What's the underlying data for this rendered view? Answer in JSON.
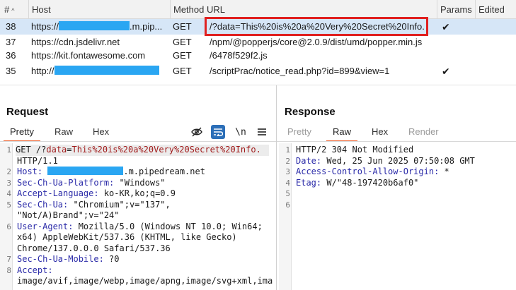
{
  "table": {
    "headers": [
      "#",
      "Host",
      "Method",
      "URL",
      "Params",
      "Edited"
    ],
    "sort_indicator": "^",
    "rows": [
      {
        "num": "38",
        "host_prefix": "https://",
        "host_suffix": ".m.pip...",
        "method": "GET",
        "url": "/?data=This%20is%20a%20Very%20Secret%20Info.",
        "params": "✔",
        "selected": true
      },
      {
        "num": "37",
        "host_prefix": "https://cdn.jsdelivr.net",
        "host_suffix": "",
        "method": "GET",
        "url": "/npm/@popperjs/core@2.0.9/dist/umd/popper.min.js",
        "params": "",
        "selected": false
      },
      {
        "num": "36",
        "host_prefix": "https://kit.fontawesome.com",
        "host_suffix": "",
        "method": "GET",
        "url": "/6478f529f2.js",
        "params": "",
        "selected": false
      },
      {
        "num": "35",
        "host_prefix": "http://",
        "host_suffix": "",
        "method": "GET",
        "url": "/scriptPrac/notice_read.php?id=899&view=1",
        "params": "✔",
        "selected": false
      }
    ]
  },
  "request": {
    "title": "Request",
    "tabs": [
      "Pretty",
      "Raw",
      "Hex"
    ],
    "active_tab": "Pretty",
    "tools": {
      "hide_icon": "eye-slash-icon",
      "wrap_icon": "wrap-lines-icon",
      "newline_label": "\\n",
      "menu_icon": "hamburger-menu-icon"
    },
    "lines": {
      "l1_method": "GET /?",
      "l1_param": "data",
      "l1_eq": "=",
      "l1_value": "This%20is%20a%20Very%20Secret%20Info.",
      "l1_version": "HTTP/1.1",
      "l2_name": "Host:",
      "l2_suffix": ".m.pipedream.net",
      "l3_name": "Sec-Ch-Ua-Platform:",
      "l3_value": " \"Windows\"",
      "l4_name": "Accept-Language:",
      "l4_value": " ko-KR,ko;q=0.9",
      "l5_name": "Sec-Ch-Ua:",
      "l5_value_a": " \"Chromium\";v=\"137\",",
      "l5_value_b": "\"Not/A)Brand\";v=\"24\"",
      "l6_name": "User-Agent:",
      "l6_value_a": " Mozilla/5.0 (Windows NT 10.0; Win64;",
      "l6_value_b": "x64) AppleWebKit/537.36 (KHTML, like Gecko)",
      "l6_value_c": "Chrome/137.0.0.0 Safari/537.36",
      "l7_name": "Sec-Ch-Ua-Mobile:",
      "l7_value": " ?0",
      "l8_name": "Accept:",
      "l8_value": "image/avif,image/webp,image/apng,image/svg+xml,ima"
    },
    "line_numbers": [
      "1",
      "2",
      "3",
      "4",
      "5",
      "6",
      "7",
      "8"
    ]
  },
  "response": {
    "title": "Response",
    "tabs": [
      "Pretty",
      "Raw",
      "Hex",
      "Render"
    ],
    "active_tab": "Raw",
    "lines": {
      "l1": "HTTP/2 304 Not Modified",
      "l2_name": "Date:",
      "l2_value": " Wed, 25 Jun 2025 07:50:08 GMT",
      "l3_name": "Access-Control-Allow-Origin:",
      "l3_value": " *",
      "l4_name": "Etag:",
      "l4_value": " W/\"48-197420b6af0\""
    },
    "line_numbers": [
      "1",
      "2",
      "3",
      "4",
      "5",
      "6"
    ]
  },
  "colors": {
    "selected_row": "#d6e6f7",
    "redaction": "#2aa6f2",
    "highlight_box": "#e02020",
    "active_tab_underline": "#f0622d",
    "header_name": "#2a2aa8",
    "param": "#a11c1c"
  }
}
